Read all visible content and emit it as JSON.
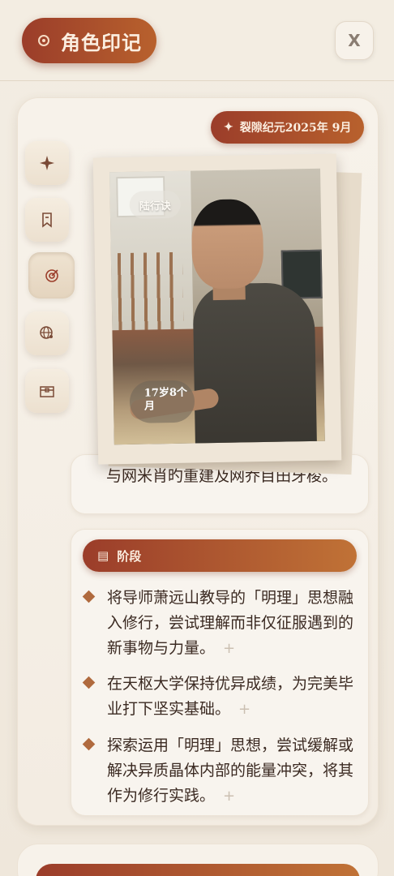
{
  "header": {
    "title": "角色印记",
    "close_label": "X"
  },
  "card": {
    "date_badge": "裂隙纪元2025年 9月",
    "portrait": {
      "name": "陆行诀",
      "age": "17岁8个月"
    },
    "side_buttons": [
      {
        "icon": "sparkle-icon"
      },
      {
        "icon": "bookmark-icon"
      },
      {
        "icon": "target-icon"
      },
      {
        "icon": "globe-user-icon"
      },
      {
        "icon": "box-icon"
      }
    ],
    "previous_text": "与网米肖旳重建及网乔目田牙梭。",
    "stage_section": {
      "label": "阶段",
      "items": [
        "将导师萧远山教导的「明理」思想融入修行，尝试理解而非仅征服遇到的新事物与力量。",
        "在天枢大学保持优异成绩，为完美毕业打下坚实基础。",
        "探索运用「明理」思想，尝试缓解或解决异质晶体内部的能量冲突，将其作为修行实践。"
      ],
      "add_symbol": "+"
    }
  },
  "colors": {
    "accent_start": "#9b3d2a",
    "accent_end": "#c07236",
    "background": "#f3ede3"
  }
}
